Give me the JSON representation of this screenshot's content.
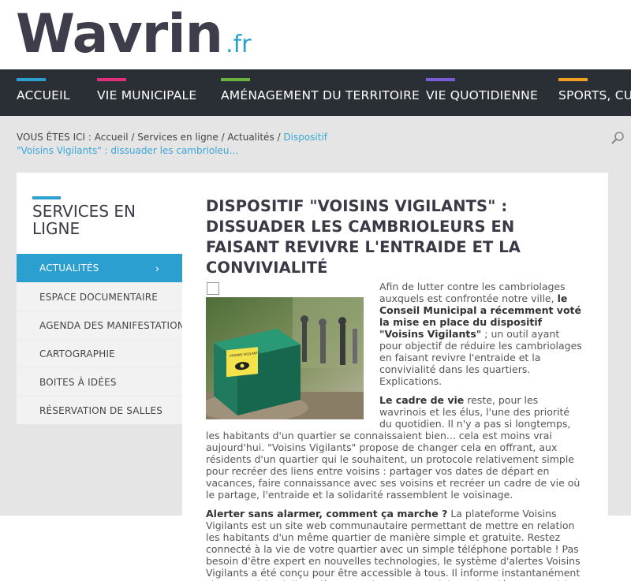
{
  "logo": {
    "main": "Wavrin",
    "tld": ".fr"
  },
  "nav": [
    {
      "label": "ACCUEIL",
      "color": "#2a9fd0"
    },
    {
      "label": "VIE MUNICIPALE",
      "color": "#e0307c"
    },
    {
      "label": "AMÉNAGEMENT DU TERRITOIRE",
      "color": "#6ab23e"
    },
    {
      "label": "VIE QUOTIDIENNE",
      "color": "#7a5cd6"
    },
    {
      "label": "SPORTS, CULT",
      "color": "#f0a020"
    }
  ],
  "breadcrumb": {
    "prefix": "VOUS ÊTES ICI : ",
    "items": [
      "Accueil",
      "Services en ligne",
      "Actualités"
    ],
    "current": "Dispositif \"Voisins Vigilants\" : dissuader les cambrioleu..."
  },
  "sidebar": {
    "title": "SERVICES EN LIGNE",
    "items": [
      {
        "label": "ACTUALITÉS",
        "active": true
      },
      {
        "label": "ESPACE DOCUMENTAIRE"
      },
      {
        "label": "AGENDA DES MANIFESTATIONS"
      },
      {
        "label": "CARTOGRAPHIE"
      },
      {
        "label": "BOITES À IDÉES"
      },
      {
        "label": "RÉSERVATION DE SALLES"
      }
    ]
  },
  "article": {
    "title": "DISPOSITIF \"VOISINS VIGILANTS\" : DISSUADER LES CAMBRIOLEURS EN FAISANT REVIVRE L'ENTRAIDE ET LA CONVIVIALITÉ",
    "p1_a": "Afin de lutter contre les cambriolages auxquels est confrontée notre ville, ",
    "p1_b": "le Conseil Municipal a récemment voté la mise en place du dispositif \"Voisins Vigilants\"",
    "p1_c": " ; un outil ayant pour objectif de réduire les cambriolages en faisant revivre l'entraide et la convivialité dans les quartiers. Explications.",
    "p2_a": "Le cadre de vie",
    "p2_b": " reste, pour les wavrinois et les élus, l'une des priorité du quotidien. Il n'y a pas si longtemps, les habitants d'un quartier se connaissaient bien... cela est moins vrai aujourd'hui. \"Voisins Vigilants\" propose de changer cela en offrant, aux résidents d'un quartier qui le souhaitent, un protocole relativement simple pour recréer des liens entre voisins : partager vos dates de départ en vacances, faire connaissance avec ses voisins et recréer un cadre de vie où le partage, l'entraide et la solidarité rassemblent le voisinage.",
    "p3_a": "Alerter sans alarmer, comment ça marche ?",
    "p3_b": " La plateforme Voisins Vigilants est un site web communautaire permettant de mettre en relation les habitants d'un même quartier de manière simple et gratuite. Restez connecté à la vie de votre quartier avec un simple téléphone portable ! Pas besoin d'être expert en nouvelles technologies, le système d'alertes Voisins Vigilants a été conçu pour être accessible à tous. Il informe instantanément chaque voisin vigilant dès qu'un danger potentiel est signalé par un voisin ou par la police municipale.",
    "sign_text": "VOISINS VIGILANTS"
  }
}
